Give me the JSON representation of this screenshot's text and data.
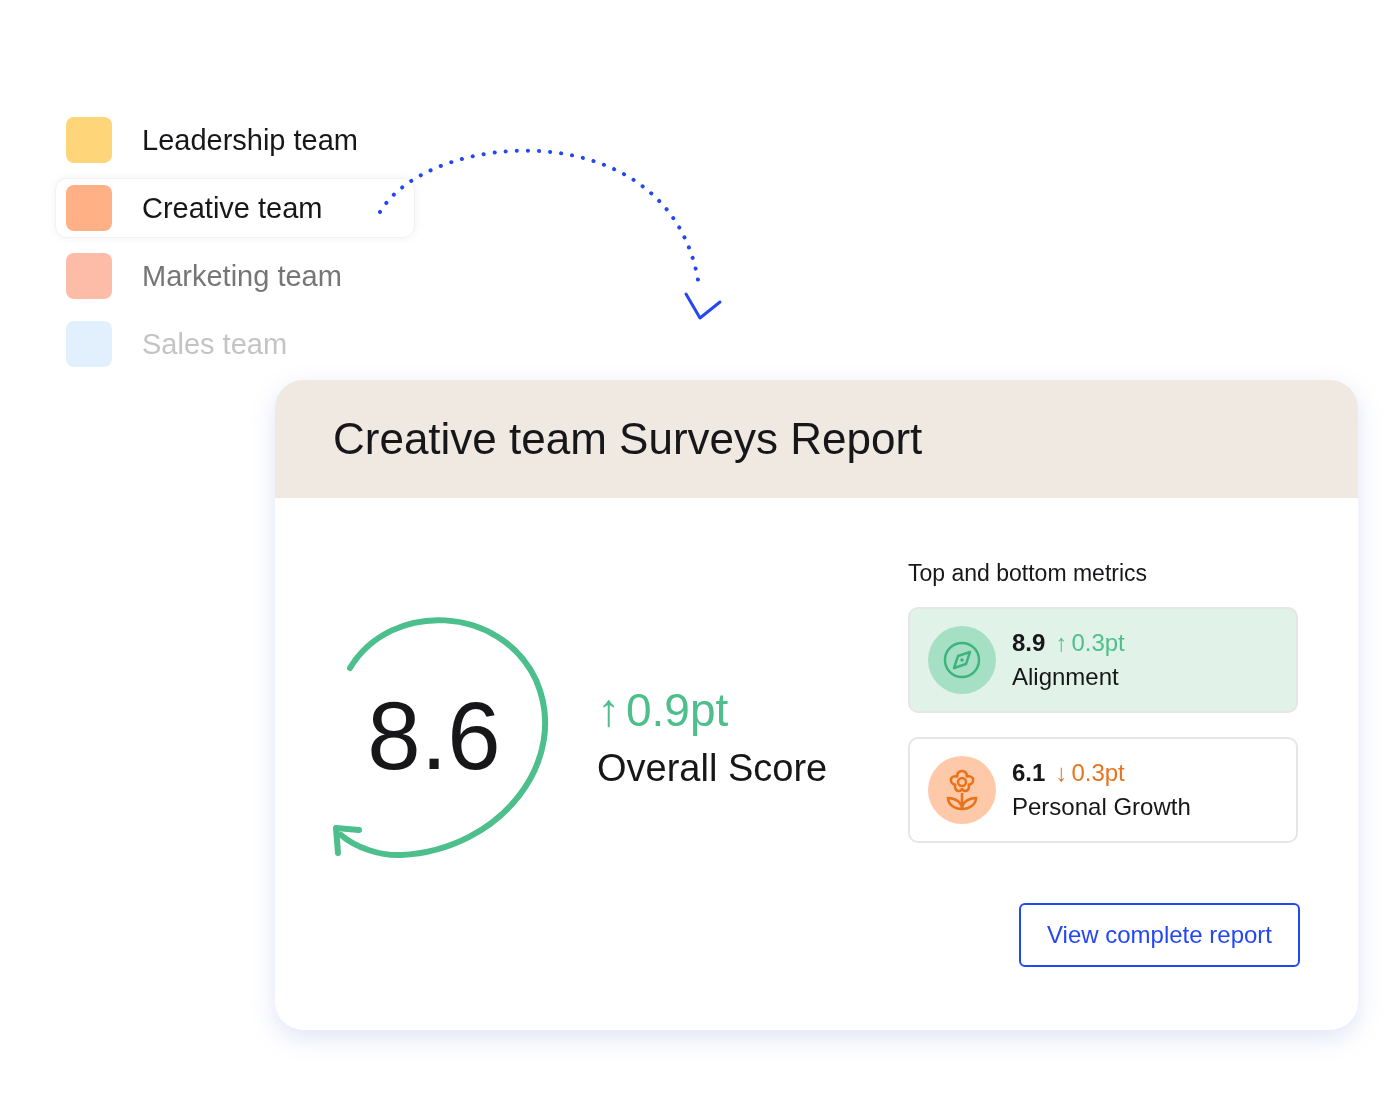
{
  "teams": [
    {
      "label": "Leadership team",
      "color": "#ffd57a",
      "selected": false
    },
    {
      "label": "Creative team",
      "color": "#ffb085",
      "selected": true
    },
    {
      "label": "Marketing team",
      "color": "#fdbca8",
      "selected": false
    },
    {
      "label": "Sales team",
      "color": "#e2effc",
      "selected": false
    }
  ],
  "report": {
    "title": "Creative team Surveys Report",
    "overall": {
      "score": "8.6",
      "arrow": "↑",
      "delta": "0.9pt",
      "label": "Overall Score"
    },
    "metrics_heading": "Top and bottom metrics",
    "metrics": [
      {
        "kind": "top",
        "value": "8.9",
        "arrow": "↑",
        "delta": "0.3pt",
        "label": "Alignment"
      },
      {
        "kind": "bottom",
        "value": "6.1",
        "arrow": "↓",
        "delta": "0.3pt",
        "label": "Personal Growth"
      }
    ],
    "button": "View complete report"
  }
}
